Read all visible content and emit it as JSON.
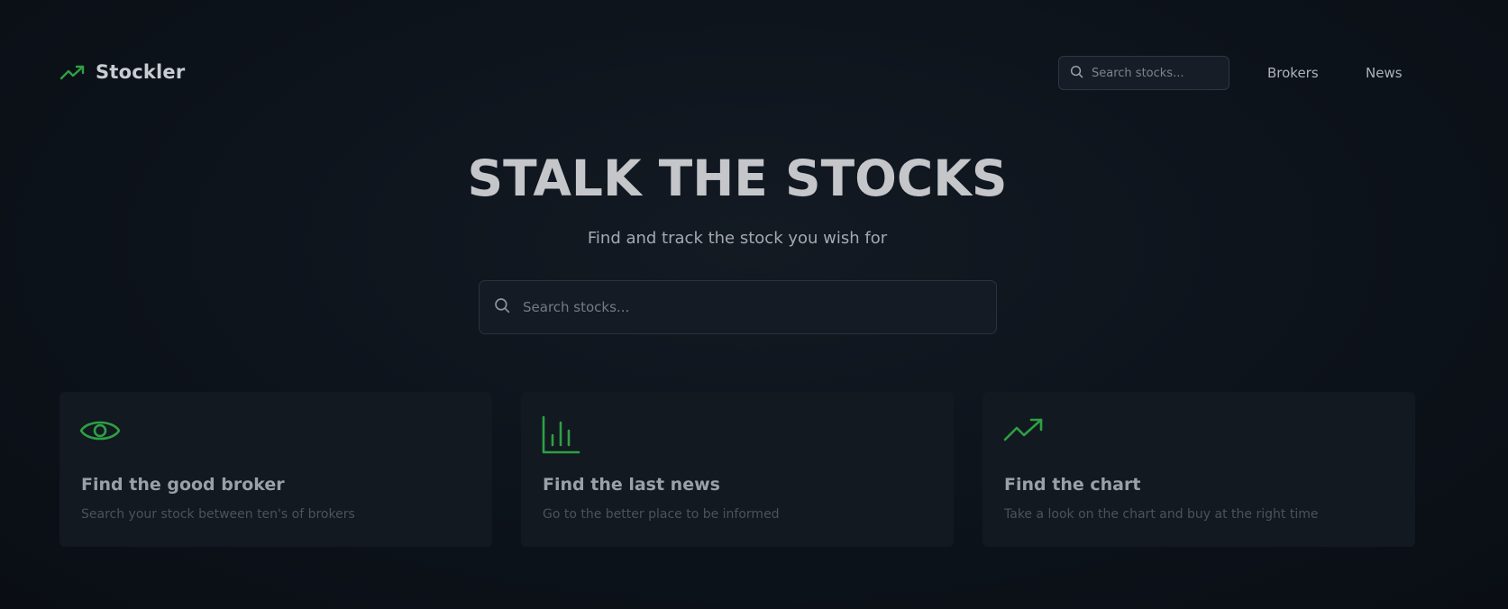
{
  "app": {
    "name": "Stockler",
    "logo_icon": "trending-up-icon",
    "accent_color": "#2ea043"
  },
  "header": {
    "search": {
      "placeholder": "Search stocks...",
      "icon": "search-icon"
    },
    "nav": [
      {
        "label": "Brokers"
      },
      {
        "label": "News"
      }
    ]
  },
  "hero": {
    "title": "STALK THE STOCKS",
    "subtitle": "Find and track the stock you wish for",
    "search": {
      "placeholder": "Search stocks...",
      "icon": "search-icon"
    }
  },
  "features": [
    {
      "icon": "eye-icon",
      "title": "Find the good broker",
      "description": "Search your stock between ten's of brokers"
    },
    {
      "icon": "bar-chart-icon",
      "title": "Find the last news",
      "description": "Go to the better place to be informed"
    },
    {
      "icon": "trending-up-icon",
      "title": "Find the chart",
      "description": "Take a look on the chart and buy at the right time"
    }
  ]
}
